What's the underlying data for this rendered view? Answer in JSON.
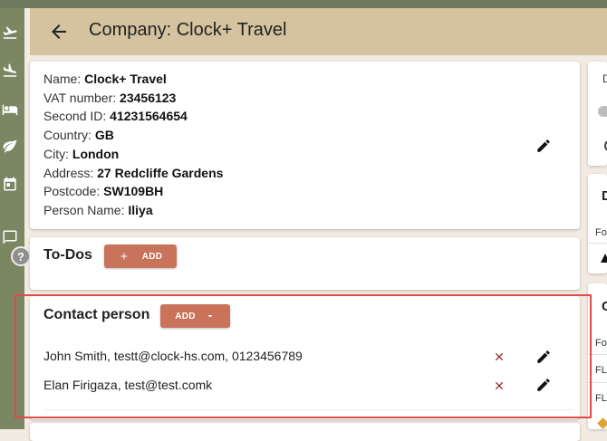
{
  "header": {
    "title": "Company: Clock+ Travel"
  },
  "company": {
    "fields": [
      {
        "label": "Name: ",
        "value": "Clock+ Travel"
      },
      {
        "label": "VAT number: ",
        "value": "23456123"
      },
      {
        "label": "Second ID: ",
        "value": "41231564654"
      },
      {
        "label": "Country: ",
        "value": "GB"
      },
      {
        "label": "City: ",
        "value": "London"
      },
      {
        "label": "Address: ",
        "value": "27 Redcliffe Gardens"
      },
      {
        "label": "Postcode: ",
        "value": "SW109BH"
      },
      {
        "label": "Person Name: ",
        "value": "Iliya"
      }
    ]
  },
  "todos": {
    "title": "To-Dos",
    "add_label": "ADD",
    "add_icon": "plus-icon"
  },
  "contacts": {
    "title": "Contact person",
    "add_label": "ADD",
    "rows": [
      {
        "text": "John Smith, testt@clock-hs.com, 0123456789"
      },
      {
        "text": "Elan Firigaza, test@test.comk"
      }
    ]
  },
  "right_panel": {
    "card1_text": "D",
    "card2_title": "D",
    "card2_row": "Fo",
    "card3_title": "C",
    "card3_rows": [
      "Fo",
      "FL",
      "FL"
    ]
  },
  "sidebar": {
    "icons": [
      "plane-takeoff-icon",
      "plane-landing-icon",
      "bed-icon",
      "leaf-icon",
      "calendar-icon",
      "chat-icon"
    ],
    "help_label": "?"
  },
  "colors": {
    "header": "#d4c39e",
    "sidebar": "#7b8663",
    "accent": "#c8735a",
    "delete": "#8b1d1d"
  }
}
